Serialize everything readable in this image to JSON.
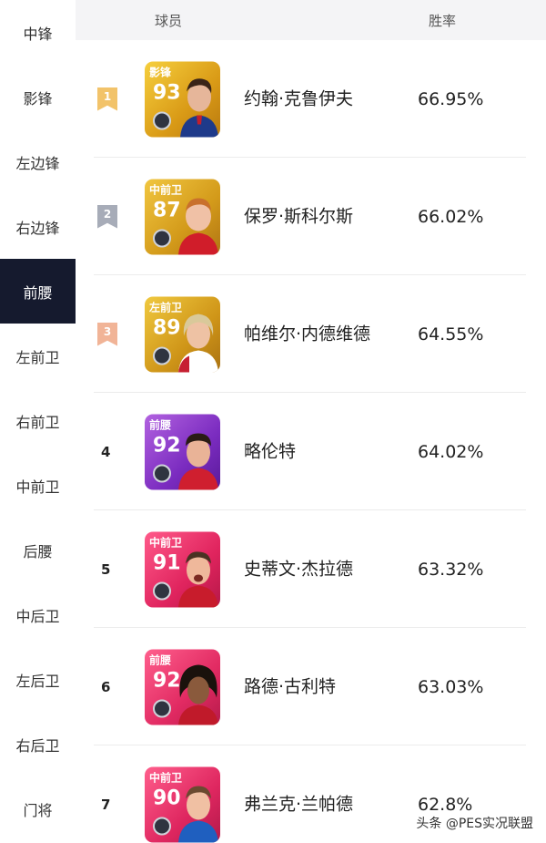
{
  "sidebar": {
    "items": [
      {
        "label": "中锋"
      },
      {
        "label": "影锋"
      },
      {
        "label": "左边锋"
      },
      {
        "label": "右边锋"
      },
      {
        "label": "前腰",
        "active": true
      },
      {
        "label": "左前卫"
      },
      {
        "label": "右前卫"
      },
      {
        "label": "中前卫"
      },
      {
        "label": "后腰"
      },
      {
        "label": "中后卫"
      },
      {
        "label": "左后卫"
      },
      {
        "label": "右后卫"
      },
      {
        "label": "门将"
      }
    ]
  },
  "table": {
    "header_player": "球员",
    "header_rate": "胜率",
    "rows": [
      {
        "rank": "1",
        "position": "影锋",
        "rating": "93",
        "name": "约翰·克鲁伊夫",
        "win_rate": "66.95%",
        "card_color": "gold",
        "card_icon": "player-portrait-icon"
      },
      {
        "rank": "2",
        "position": "中前卫",
        "rating": "87",
        "name": "保罗·斯科尔斯",
        "win_rate": "66.02%",
        "card_color": "gold",
        "card_icon": "player-portrait-icon"
      },
      {
        "rank": "3",
        "position": "左前卫",
        "rating": "89",
        "name": "帕维尔·内德维德",
        "win_rate": "64.55%",
        "card_color": "gold",
        "card_icon": "player-portrait-icon"
      },
      {
        "rank": "4",
        "position": "前腰",
        "rating": "92",
        "name": "略伦特",
        "win_rate": "64.02%",
        "card_color": "purple",
        "card_icon": "player-portrait-icon"
      },
      {
        "rank": "5",
        "position": "中前卫",
        "rating": "91",
        "name": "史蒂文·杰拉德",
        "win_rate": "63.32%",
        "card_color": "pink",
        "card_icon": "player-portrait-icon"
      },
      {
        "rank": "6",
        "position": "前腰",
        "rating": "92",
        "name": "路德·古利特",
        "win_rate": "63.03%",
        "card_color": "pink",
        "card_icon": "player-portrait-icon"
      },
      {
        "rank": "7",
        "position": "中前卫",
        "rating": "90",
        "name": "弗兰克·兰帕德",
        "win_rate": "62.8%",
        "card_color": "pink",
        "card_icon": "player-portrait-icon"
      }
    ]
  },
  "colors": {
    "sidebar_active": "#151a2e",
    "gold_badge": "#f2c36a",
    "silver_badge": "#a7acb8",
    "bronze_badge": "#f1b497"
  },
  "watermark": "头条 @PES实况联盟"
}
